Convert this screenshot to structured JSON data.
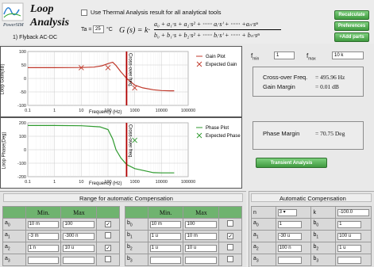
{
  "logo": {
    "brand": "PowerSIM",
    "title_line1": "Loop",
    "title_line2": "Analysis",
    "subtitle": "1) Flyback AC-DC"
  },
  "thermal": {
    "label": "Use Thermal Analysis result for all analytical tools",
    "checked": false
  },
  "ta": {
    "label": "Ta =",
    "value": "25",
    "unit": "°C"
  },
  "formula": {
    "lhs": "G (s) = k·",
    "numerator": "a₀ + a₁·s + a₂·s² + ······ aᵢ·sⁱ + ······ +aₙ·sⁿ",
    "denominator": "b₀ + b₁·s + b₂·s² + ······ bᵢ·sⁱ + ······ + bₙ·sⁿ"
  },
  "buttons": {
    "recalculate": "Recalculate",
    "preferences": "Preferences",
    "add_parts": "+Add parts",
    "transient": "Transient Analysis"
  },
  "gain_plot": {
    "ylabel": "Loop Gain(dB)",
    "xlabel": "Frequency (Hz)",
    "yticks": [
      "100",
      "50",
      "0",
      "-50",
      "-100"
    ],
    "xticks": [
      "0.1",
      "1",
      "10",
      "100",
      "1000",
      "10000",
      "100000"
    ],
    "legend": [
      "Gain Plot",
      "Expected Gain"
    ],
    "marker_label": "Cross-over freq.",
    "legend_colors": [
      "#c0392b",
      "#c0392b"
    ]
  },
  "phase_plot": {
    "ylabel": "Loop Phase(Deg)",
    "xlabel": "Frequency (Hz)",
    "yticks": [
      "200",
      "100",
      "0",
      "-100",
      "-200"
    ],
    "xticks": [
      "0.1",
      "1",
      "10",
      "100",
      "1000",
      "10000",
      "100000"
    ],
    "legend": [
      "Phase Plot",
      "Expected Phase"
    ],
    "marker_label": "Cross-over freq.",
    "legend_colors": [
      "#2e9a2e",
      "#2e9a2e"
    ]
  },
  "chart_data": [
    {
      "type": "line",
      "title": "",
      "xlabel": "Frequency (Hz)",
      "ylabel": "Loop Gain(dB)",
      "xscale": "log",
      "xlim": [
        0.1,
        100000
      ],
      "ylim": [
        -100,
        100
      ],
      "grid": true,
      "legend": "right",
      "series": [
        {
          "name": "Gain Plot",
          "x": [
            0.1,
            1,
            10,
            30,
            60,
            100,
            150,
            200,
            300,
            500,
            700,
            1000,
            2000,
            5000,
            10000,
            20000,
            30000
          ],
          "y": [
            40,
            40,
            40.5,
            42,
            47,
            55,
            60,
            48,
            25,
            0,
            -12,
            -25,
            -35,
            -42,
            -45,
            -46,
            -46
          ]
        },
        {
          "name": "Expected Gain",
          "x": [
            10,
            100,
            1000
          ],
          "y": [
            40,
            40,
            -35
          ]
        }
      ],
      "annotations": [
        {
          "x": 495.96,
          "text": "Cross-over freq."
        }
      ]
    },
    {
      "type": "line",
      "title": "",
      "xlabel": "Frequency (Hz)",
      "ylabel": "Loop Phase(Deg)",
      "xscale": "log",
      "xlim": [
        0.1,
        100000
      ],
      "ylim": [
        -200,
        200
      ],
      "grid": true,
      "legend": "right",
      "series": [
        {
          "name": "Phase Plot",
          "x": [
            0.1,
            1,
            10,
            50,
            100,
            150,
            200,
            300,
            495.96,
            1000,
            5000,
            10000,
            30000
          ],
          "y": [
            180,
            180,
            178,
            170,
            150,
            80,
            0,
            -60,
            -109.25,
            -140,
            -170,
            -172,
            -172
          ]
        },
        {
          "name": "Expected Phase",
          "x": [
            1000
          ],
          "y": [
            70
          ]
        }
      ],
      "annotations": [
        {
          "x": 495.96,
          "text": "Cross-over freq."
        }
      ]
    }
  ],
  "fmin": {
    "label": "f",
    "sub": "min",
    "value": "1"
  },
  "fmax": {
    "label": "f",
    "sub": "max",
    "value": "10 k"
  },
  "results": {
    "crossover_label": "Cross-over Freq.",
    "crossover_value": "= 495.96 Hz",
    "gain_margin_label": "Gain Margin",
    "gain_margin_value": "= 0.01 dB",
    "phase_margin_label": "Phase Margin",
    "phase_margin_value": "= 70.75 Deg"
  },
  "range_section": {
    "title": "Range for automatic Compensation",
    "min_header": "Min.",
    "max_header": "Max",
    "a_rows": [
      {
        "label": "a",
        "sub": "0",
        "min": "10 m",
        "max": "100",
        "checked": true
      },
      {
        "label": "a",
        "sub": "1",
        "min": "-3 m",
        "max": "-300 n",
        "checked": false
      },
      {
        "label": "a",
        "sub": "2",
        "min": "1 n",
        "max": "10 u",
        "checked": true
      },
      {
        "label": "a",
        "sub": "3",
        "min": "",
        "max": "",
        "checked": false
      }
    ],
    "b_rows": [
      {
        "label": "b",
        "sub": "0",
        "min": "10 m",
        "max": "100",
        "checked": false
      },
      {
        "label": "b",
        "sub": "1",
        "min": "1 u",
        "max": "10 m",
        "checked": true
      },
      {
        "label": "b",
        "sub": "2",
        "min": "1 u",
        "max": "10 u",
        "checked": false
      },
      {
        "label": "b",
        "sub": "3",
        "min": "",
        "max": "",
        "checked": false
      }
    ]
  },
  "auto_comp": {
    "title": "Automatic Compensation",
    "n_label": "n",
    "n_value": "3",
    "k_label": "k",
    "k_value": "-100.0",
    "rows": [
      {
        "a_label": "a",
        "a_sub": "0",
        "a_value": "1",
        "b_label": "b",
        "b_sub": "0",
        "b_value": "1"
      },
      {
        "a_label": "a",
        "a_sub": "1",
        "a_value": "-30 u",
        "b_label": "b",
        "b_sub": "1",
        "b_value": "100 u"
      },
      {
        "a_label": "a",
        "a_sub": "2",
        "a_value": "100 n",
        "b_label": "b",
        "b_sub": "2",
        "b_value": "1 u"
      },
      {
        "a_label": "a",
        "a_sub": "3",
        "a_value": "",
        "b_label": "b",
        "b_sub": "3",
        "b_value": ""
      }
    ]
  },
  "colors": {
    "accent_green": "#6fb36f",
    "gain": "#c0392b",
    "phase": "#2e9a2e",
    "crossover": "#b00000"
  }
}
